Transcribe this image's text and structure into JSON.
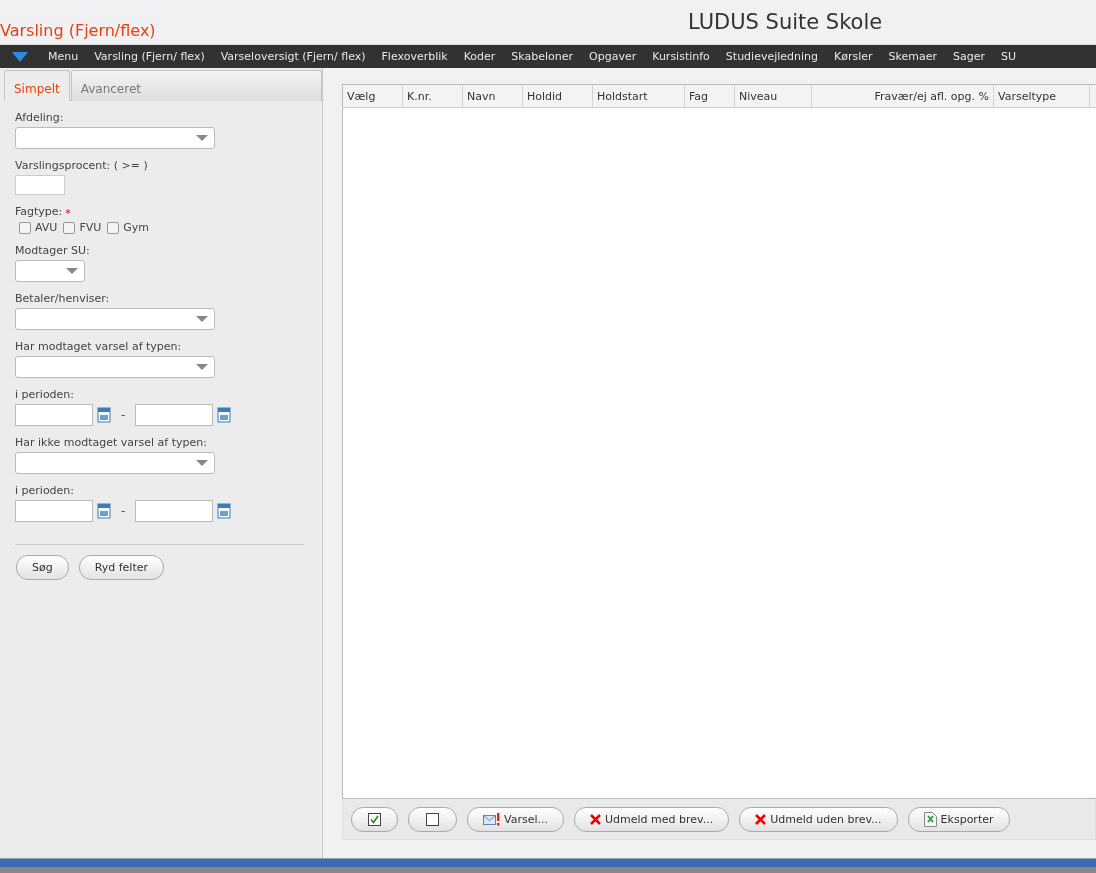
{
  "page_title": "Varsling (Fjern/flex)",
  "app_title": "LUDUS Suite Skole",
  "nav": [
    "Menu",
    "Varsling (Fjern/ flex)",
    "Varseloversigt (Fjern/ flex)",
    "Flexoverblik",
    "Koder",
    "Skabeloner",
    "Opgaver",
    "Kursistinfo",
    "Studievejledning",
    "Kørsler",
    "Skemaer",
    "Sager",
    "SU"
  ],
  "tabs": [
    {
      "label": "Simpelt",
      "selected": true
    },
    {
      "label": "Avanceret",
      "selected": false
    }
  ],
  "fields": [
    {
      "kind": "select",
      "label": "Afdeling:"
    },
    {
      "kind": "text",
      "label": "Varslingsprocent: ( >= )"
    },
    {
      "kind": "checkboxes",
      "label": "Fagtype:",
      "required_mark": "*",
      "options": [
        {
          "label": "AVU",
          "checked": false
        },
        {
          "label": "FVU",
          "checked": false
        },
        {
          "label": "Gym",
          "checked": false
        }
      ]
    },
    {
      "kind": "short-select",
      "label": "Modtager SU:"
    },
    {
      "kind": "select",
      "label": "Betaler/henviser:"
    },
    {
      "kind": "select",
      "label": "Har modtaget varsel af typen:"
    },
    {
      "kind": "daterange",
      "label": "i perioden:",
      "separator": "-"
    },
    {
      "kind": "select",
      "label": "Har ikke modtaget varsel af typen:"
    },
    {
      "kind": "daterange",
      "label": "i perioden:",
      "separator": "-"
    }
  ],
  "form_buttons": [
    "Søg",
    "Ryd felter"
  ],
  "table": {
    "columns": [
      "Vælg",
      "K.nr.",
      "Navn",
      "Holdid",
      "Holdstart",
      "Fag",
      "Niveau",
      "Fravær/ej afl. opg. %",
      "Varseltype"
    ]
  },
  "actions": [
    {
      "kind": "check-all"
    },
    {
      "kind": "uncheck-all"
    },
    {
      "kind": "mail",
      "label": "Varsel..."
    },
    {
      "kind": "remove",
      "label": "Udmeld med brev..."
    },
    {
      "kind": "remove",
      "label": "Udmeld uden brev..."
    },
    {
      "kind": "export",
      "label": "Eksporter"
    }
  ]
}
